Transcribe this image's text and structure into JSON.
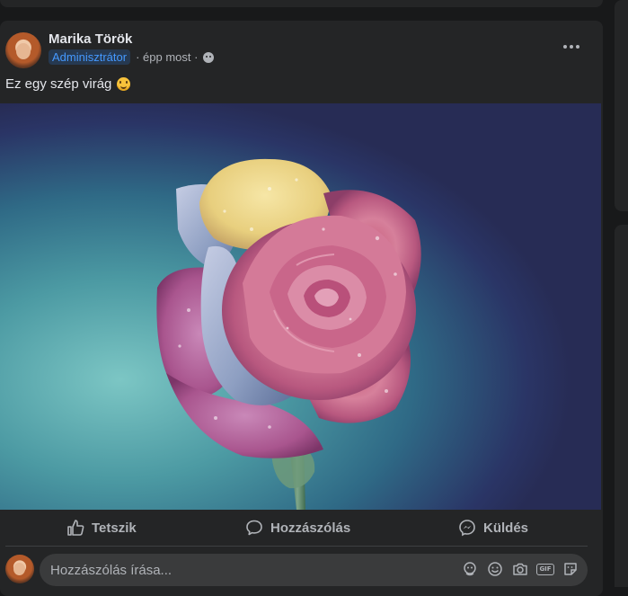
{
  "post": {
    "author": "Marika Török",
    "badge": "Adminisztrátor",
    "time": "· épp most ·",
    "text": "Ez egy szép virág",
    "privacy_icon": "globe-icon",
    "text_emoji": "smile-icon"
  },
  "actions": {
    "like": "Tetszik",
    "comment": "Hozzászólás",
    "share": "Küldés"
  },
  "comment": {
    "placeholder": "Hozzászólás írása...",
    "icons": [
      "avatar-sticker-icon",
      "emoji-icon",
      "camera-icon",
      "gif-icon",
      "sticker-icon"
    ],
    "gif_label": "GIF"
  },
  "colors": {
    "background": "#18191a",
    "card": "#242526",
    "text_primary": "#e4e6eb",
    "text_secondary": "#b0b3b8",
    "badge_text": "#4599ff",
    "badge_bg": "#263951",
    "input_bg": "#3a3b3c"
  }
}
